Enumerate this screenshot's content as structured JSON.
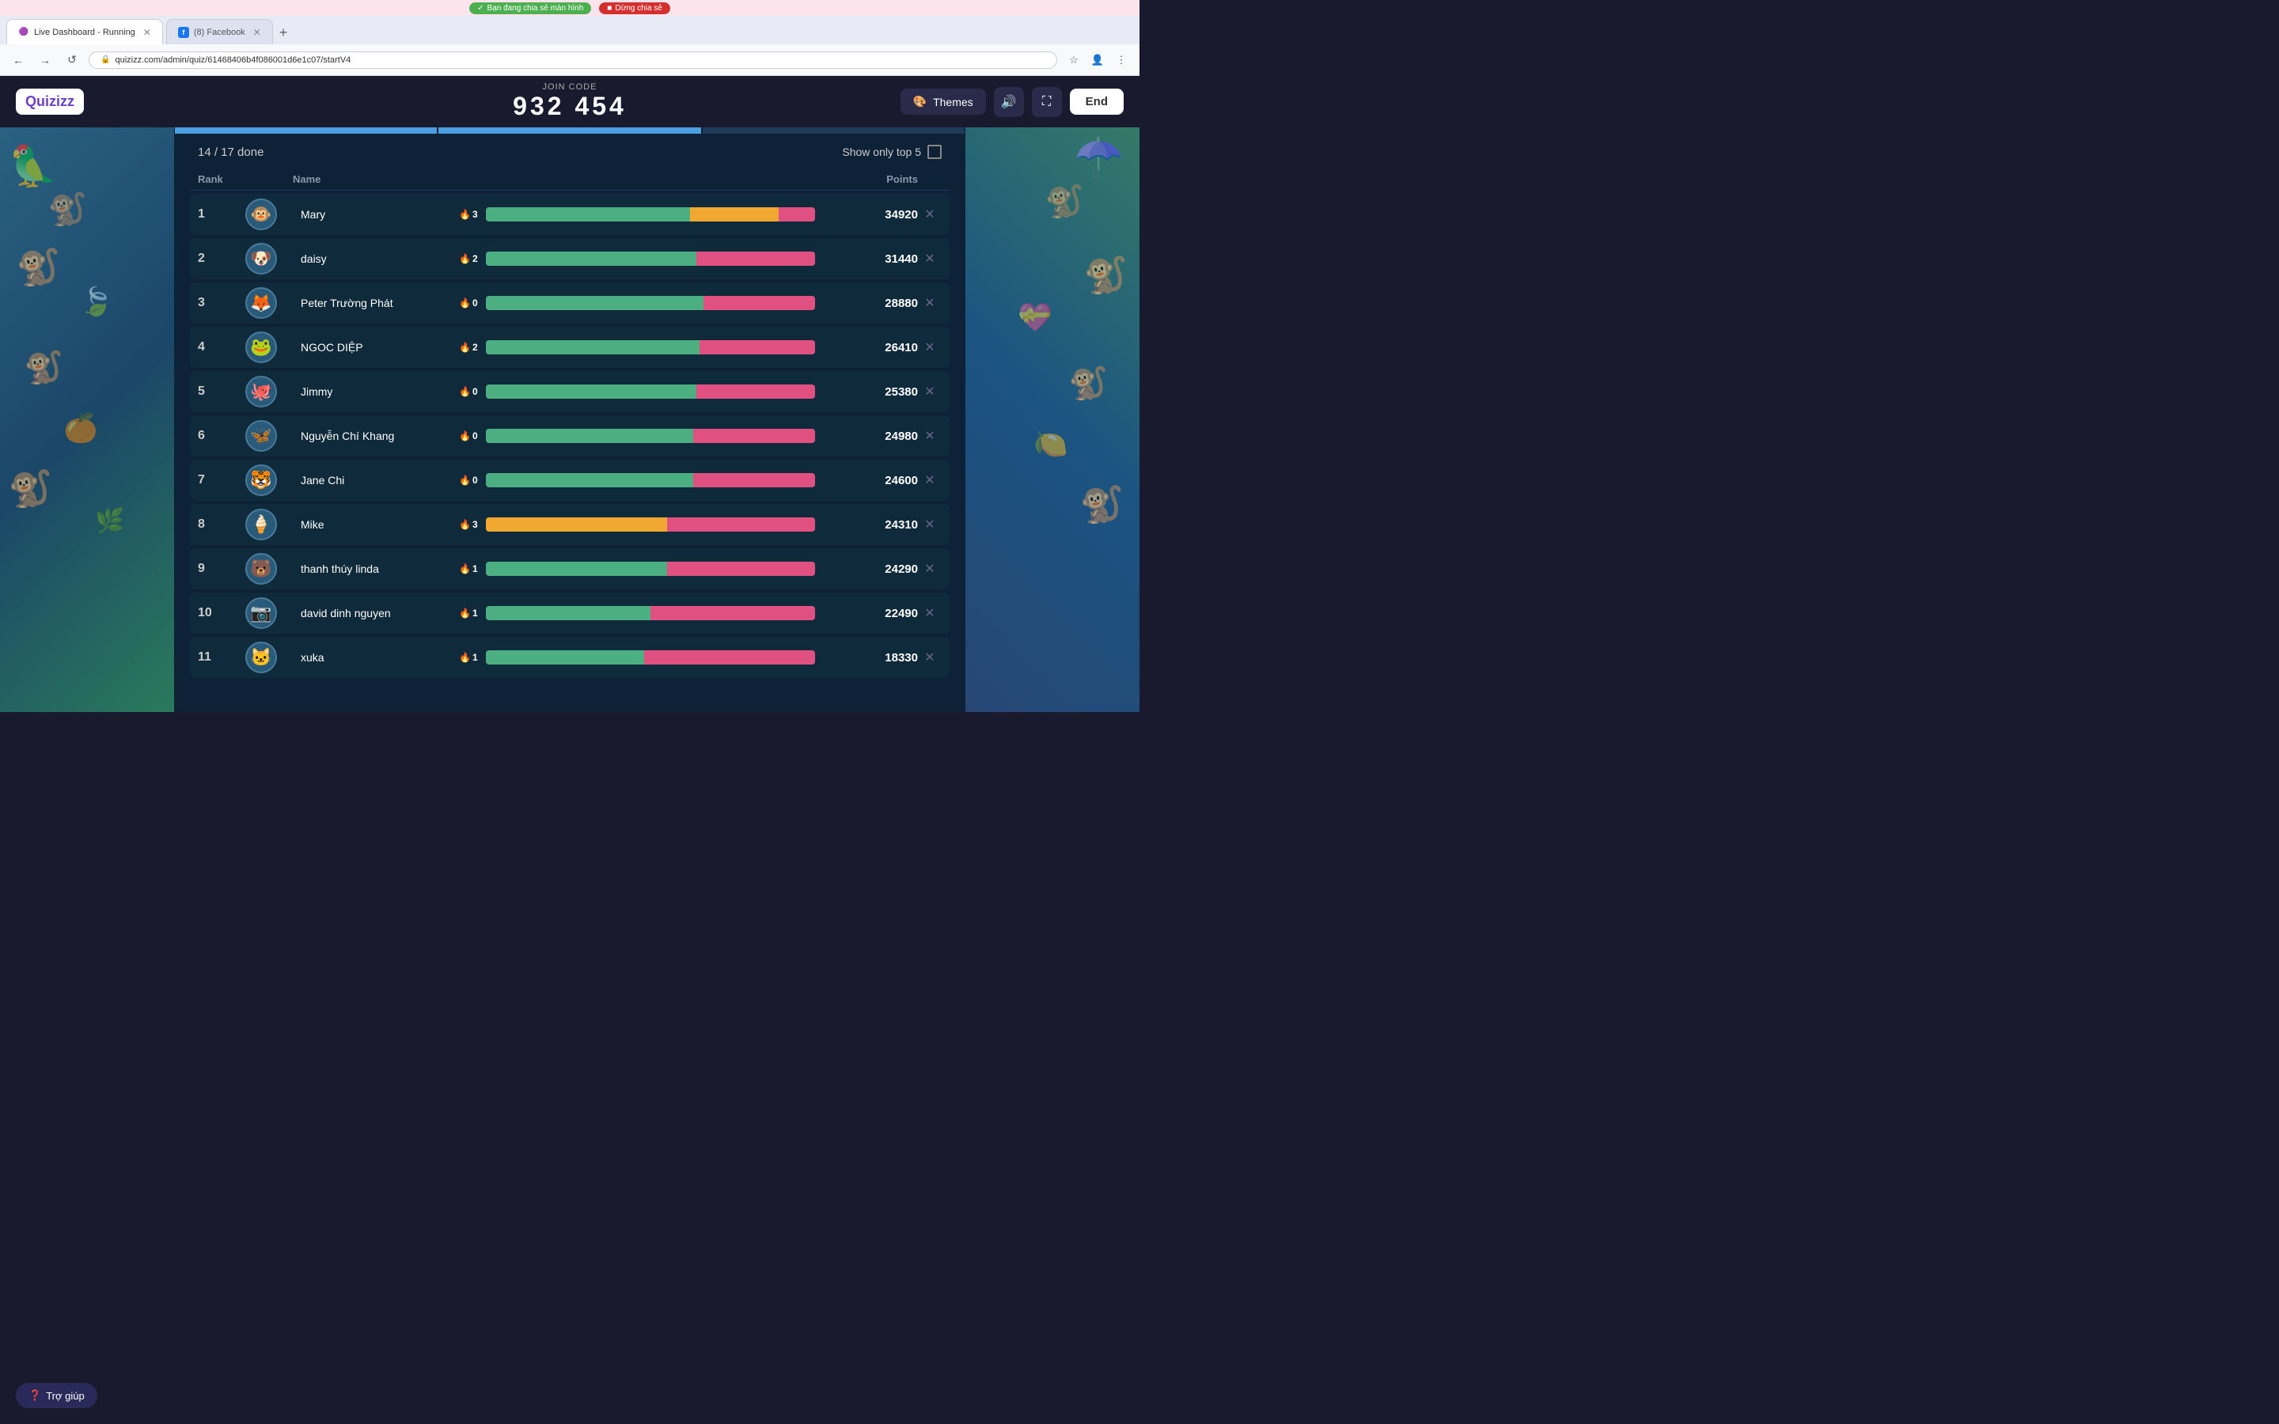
{
  "browser": {
    "top_banner": {
      "sharing_text": "Bạn đang chia sẻ màn hình",
      "stop_text": "Dừng chia sẻ"
    },
    "tabs": [
      {
        "label": "Live Dashboard - Running",
        "active": true,
        "favicon": "🟣"
      },
      {
        "label": "(8) Facebook",
        "active": false,
        "favicon": "f"
      }
    ],
    "url": "quizizz.com/admin/quiz/61468406b4f086001d6e1c07/startV4"
  },
  "header": {
    "logo": "Quizizz",
    "join_code_label": "JOIN CODE",
    "join_code": "932 454",
    "themes_label": "Themes",
    "end_label": "End"
  },
  "leaderboard": {
    "done_text": "14 / 17 done",
    "show_top5_label": "Show only top 5",
    "columns": {
      "rank": "Rank",
      "name": "Name",
      "points": "Points"
    },
    "players": [
      {
        "rank": 1,
        "name": "Mary",
        "streak": 3,
        "streak_type": "fire",
        "bar_green": 62,
        "bar_orange": 27,
        "bar_pink": 11,
        "points": 34920,
        "avatar": "🐵"
      },
      {
        "rank": 2,
        "name": "daisy",
        "streak": 2,
        "streak_type": "fire",
        "bar_green": 64,
        "bar_orange": 0,
        "bar_pink": 36,
        "points": 31440,
        "avatar": "🐶"
      },
      {
        "rank": 3,
        "name": "Peter Trường Phát",
        "streak": 0,
        "streak_type": "fire",
        "bar_green": 66,
        "bar_orange": 0,
        "bar_pink": 34,
        "points": 28880,
        "avatar": "🦊"
      },
      {
        "rank": 4,
        "name": "NGOC DIỆP",
        "streak": 2,
        "streak_type": "fire",
        "bar_green": 65,
        "bar_orange": 0,
        "bar_pink": 35,
        "points": 26410,
        "avatar": "🐸"
      },
      {
        "rank": 5,
        "name": "Jimmy",
        "streak": 0,
        "streak_type": "fire",
        "bar_green": 64,
        "bar_orange": 0,
        "bar_pink": 36,
        "points": 25380,
        "avatar": "🐙"
      },
      {
        "rank": 6,
        "name": "Nguyễn Chí Khang",
        "streak": 0,
        "streak_type": "fire",
        "bar_green": 63,
        "bar_orange": 0,
        "bar_pink": 37,
        "points": 24980,
        "avatar": "🦋"
      },
      {
        "rank": 7,
        "name": "Jane Chi",
        "streak": 0,
        "streak_type": "fire",
        "bar_green": 63,
        "bar_orange": 0,
        "bar_pink": 37,
        "points": 24600,
        "avatar": "🐯"
      },
      {
        "rank": 8,
        "name": "Mike",
        "streak": 3,
        "streak_type": "fire",
        "bar_green": 0,
        "bar_orange": 55,
        "bar_pink": 45,
        "points": 24310,
        "avatar": "🍦"
      },
      {
        "rank": 9,
        "name": "thanh thúy linda",
        "streak": 1,
        "streak_type": "fire",
        "bar_green": 55,
        "bar_orange": 0,
        "bar_pink": 45,
        "points": 24290,
        "avatar": "🐻"
      },
      {
        "rank": 10,
        "name": "david dinh nguyen",
        "streak": 1,
        "streak_type": "fire",
        "bar_green": 50,
        "bar_orange": 0,
        "bar_pink": 50,
        "points": 22490,
        "avatar": "📷"
      },
      {
        "rank": 11,
        "name": "xuka",
        "streak": 1,
        "streak_type": "fire",
        "bar_green": 48,
        "bar_orange": 0,
        "bar_pink": 52,
        "points": 18330,
        "avatar": "🐱"
      }
    ]
  },
  "help": {
    "label": "Trợ giúp"
  },
  "colors": {
    "accent_purple": "#6c3fc5",
    "header_bg": "#1a1a2e",
    "panel_bg": "#0d2137",
    "row_bg": "#0f2a3a",
    "bar_green": "#4caf82",
    "bar_pink": "#e05080",
    "bar_orange": "#f0a830"
  }
}
